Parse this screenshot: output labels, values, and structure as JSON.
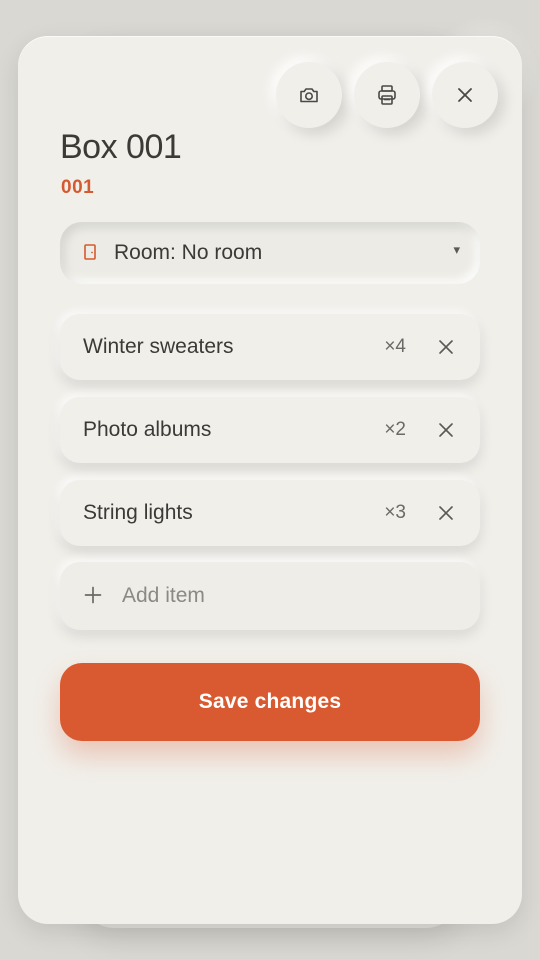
{
  "header": {
    "title": "Box 001",
    "code": "001"
  },
  "toolbar": {
    "camera_icon": "camera-icon",
    "print_icon": "printer-icon",
    "close_icon": "close-icon"
  },
  "room": {
    "label": "Room: No room",
    "icon": "door-icon",
    "caret": "▾"
  },
  "items": [
    {
      "name": "Winter sweaters",
      "qty": "×4"
    },
    {
      "name": "Photo albums",
      "qty": "×2"
    },
    {
      "name": "String lights",
      "qty": "×3"
    }
  ],
  "add_item": {
    "placeholder": "Add item"
  },
  "save": {
    "label": "Save changes"
  },
  "colors": {
    "accent": "#d95a30",
    "background": "#f1efea",
    "text": "#3b3a37"
  }
}
